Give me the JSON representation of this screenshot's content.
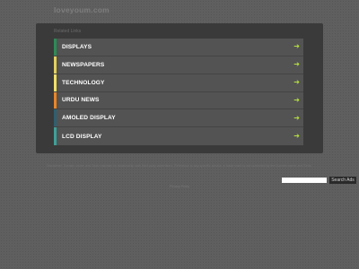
{
  "site": {
    "title": "loveyoum.com"
  },
  "panel": {
    "related_label": "Related Links",
    "items": [
      {
        "label": "DISPLAYS",
        "accent": "#2e8b57",
        "arrow": "➔",
        "arrow_color": "#b6e040"
      },
      {
        "label": "NEWSPAPERS",
        "accent": "#e0d060",
        "arrow": "➔",
        "arrow_color": "#b6e040"
      },
      {
        "label": "TECHNOLOGY",
        "accent": "#f0e068",
        "arrow": "➔",
        "arrow_color": "#b6e040"
      },
      {
        "label": "URDU NEWS",
        "accent": "#e8862a",
        "arrow": "➔",
        "arrow_color": "#b6e040"
      },
      {
        "label": "AMOLED DISPLAY",
        "accent": "#2f5f6f",
        "arrow": "➔",
        "arrow_color": "#b6e040"
      },
      {
        "label": "LCD DISPLAY",
        "accent": "#3fa098",
        "arrow": "➔",
        "arrow_color": "#b6e040"
      }
    ]
  },
  "footer": {
    "disclaimer": "Disclaimer: Domain owner and Sedo maintain no relationship with third party advertisers. Reference to any specific service or trade mark is not controlled by the Domain owner and Sedo.",
    "search_button": "Search Ads",
    "search_placeholder": "",
    "privacy": "Privacy Policy"
  }
}
